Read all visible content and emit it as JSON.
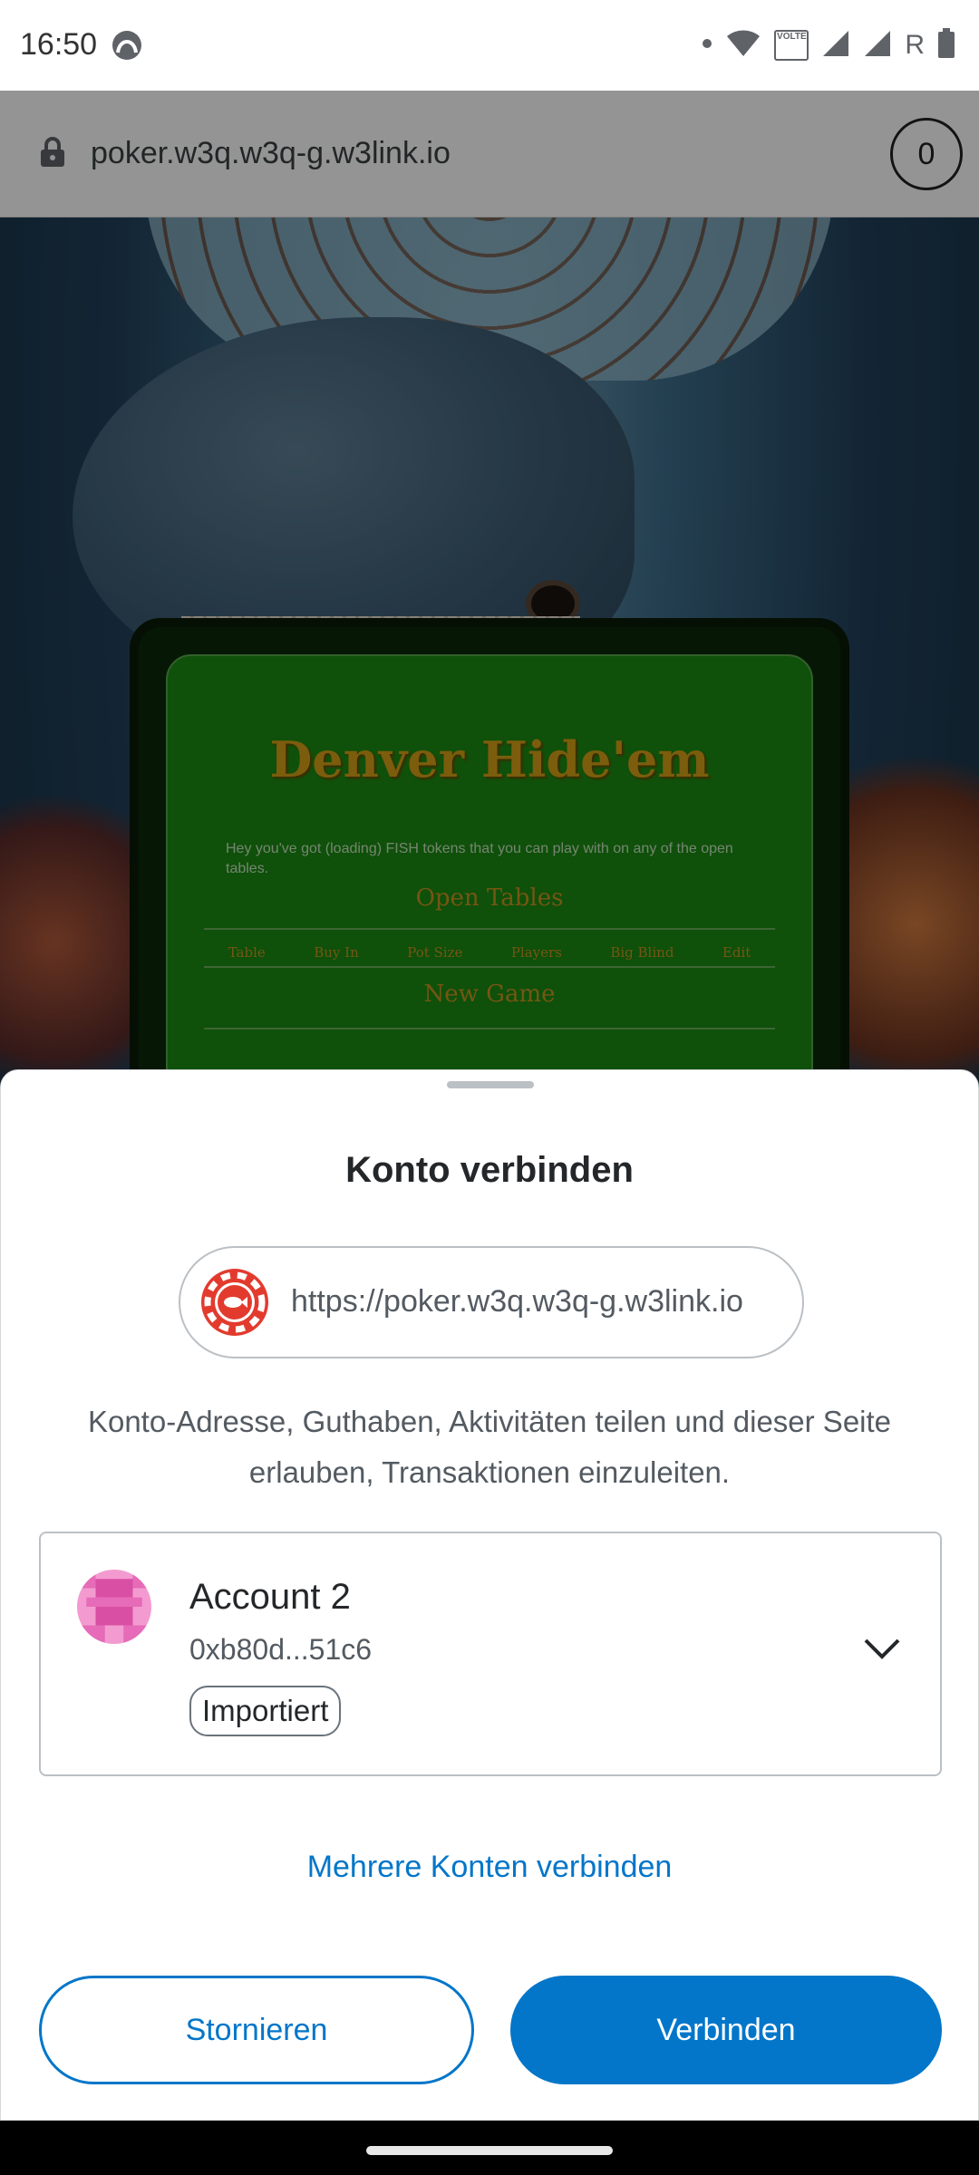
{
  "status_bar": {
    "time": "16:50",
    "icons": [
      "app-notification-icon",
      "dot-icon",
      "wifi-icon",
      "volte-icon",
      "signal-icon",
      "signal-icon",
      "roaming-icon",
      "battery-icon"
    ],
    "volte_label": "VOLTE",
    "roaming_label": "R"
  },
  "browser": {
    "url": "poker.w3q.w3q-g.w3link.io",
    "tab_count": "0"
  },
  "background_page": {
    "title": "Denver Hide'em",
    "message": "Hey you've got (loading) FISH tokens that you can play with on any of the open tables.",
    "open_tables_heading": "Open Tables",
    "table_columns": [
      "Table",
      "Buy In",
      "Pot Size",
      "Players",
      "Big Blind",
      "Edit"
    ],
    "new_game_heading": "New Game"
  },
  "sheet": {
    "title": "Konto verbinden",
    "site_url": "https://poker.w3q.w3q-g.w3link.io",
    "description": "Konto-Adresse, Guthaben, Aktivitäten teilen und dieser Seite erlauben, Transaktionen einzuleiten.",
    "account": {
      "name": "Account 2",
      "address": "0xb80d...51c6",
      "badge": "Importiert"
    },
    "multi_link": "Mehrere Konten verbinden",
    "cancel_label": "Stornieren",
    "connect_label": "Verbinden"
  },
  "colors": {
    "accent": "#0376c9",
    "game_green": "#1b8a12",
    "game_gold": "#d4a017"
  }
}
